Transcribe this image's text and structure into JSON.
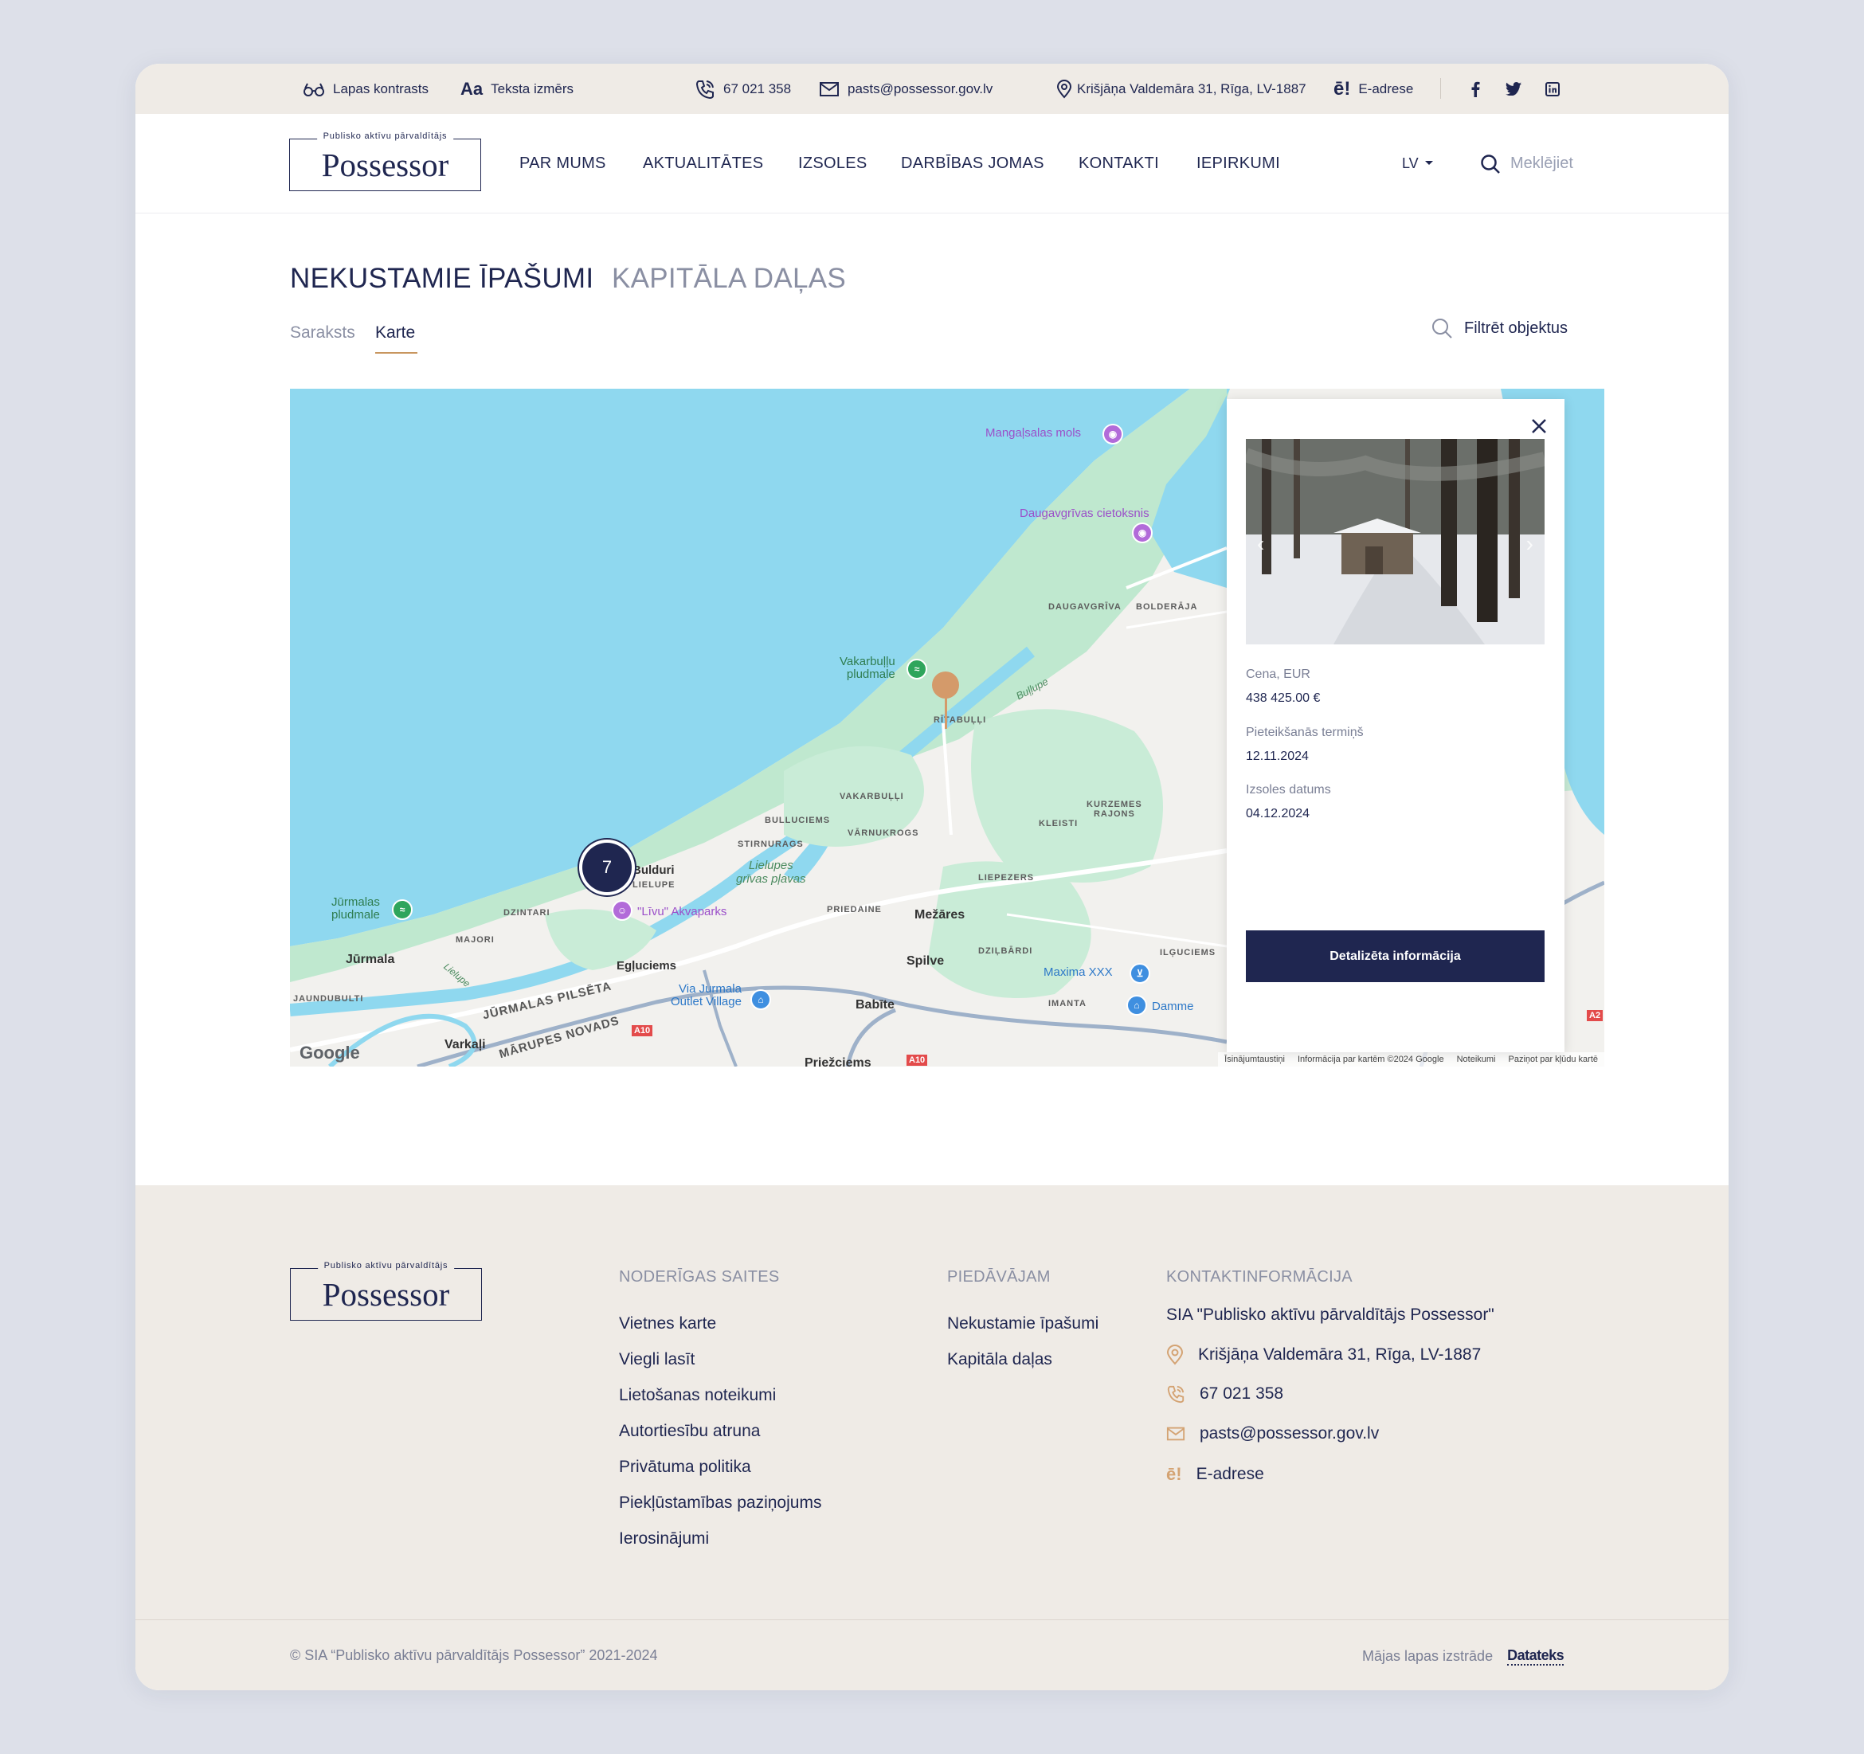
{
  "utility_bar": {
    "contrast_label": "Lapas kontrasts",
    "text_size_label": "Teksta izmērs",
    "phone": "67 021 358",
    "email": "pasts@possessor.gov.lv",
    "address": "Krišjāņa Valdemāra 31, Rīga, LV-1887",
    "e_address": "E-adrese",
    "social": [
      "facebook-icon",
      "twitter-icon",
      "linkedin-icon"
    ]
  },
  "logo": {
    "tagline": "Publisko aktīvu pārvaldītājs",
    "name": "Possessor"
  },
  "nav": {
    "items": [
      "PAR MUMS",
      "AKTUALITĀTES",
      "IZSOLES",
      "DARBĪBAS JOMAS",
      "KONTAKTI",
      "IEPIRKUMI"
    ],
    "language": "LV",
    "search_placeholder": "Meklējiet"
  },
  "page": {
    "tabs": [
      "NEKUSTAMIE ĪPAŠUMI",
      "KAPITĀLA DAĻAS"
    ],
    "active_tab": "NEKUSTAMIE ĪPAŠUMI",
    "subtabs": [
      "Saraksts",
      "Karte"
    ],
    "active_subtab": "Karte",
    "filter_label": "Filtrēt objektus"
  },
  "map": {
    "cluster_count": "7",
    "labels": {
      "mangalsalas": "Mangaļsalas mols",
      "daugavgrivas_cietoksnis": "Daugavgrīvas cietoksnis",
      "daugavgriva": "DAUGAVGRĪVA",
      "bolderaja": "BOLDERĀJA",
      "vakarbullu_pludmale": "Vakarbuļļu\npludmale",
      "ritabulli": "RĪTABUĻĻI",
      "bullupe": "Buļļupe",
      "vakarbulli": "VAKARBUĻĻI",
      "bulluciems": "BULLUCIEMS",
      "varnukrogs": "VĀRNUKROGS",
      "stirnurags": "STIRNURAGS",
      "lielupes_grivas_plavas": "Lielupes\ngrīvas pļavas",
      "kurzemes_rajons": "KURZEMES\nRAJONS",
      "kleisti": "KLEISTI",
      "liepezers": "LIEPEZERS",
      "buldurí": "Bulduri",
      "lielupe_area": "LIELUPE",
      "livu_akvaparks": "\"Līvu\" Akvaparks",
      "dzintari": "DZINTARI",
      "majori": "MAJORI",
      "jurmalas_pludmale": "Jūrmalas\npludmale",
      "jurmala": "Jūrmala",
      "priedaine": "PRIEDAINE",
      "mezares": "Mežāres",
      "dzilbardi": "DZIĻBĀRDI",
      "ilguciems": "ILĢUCIEMS",
      "jaundubulti": "JAUNDUBULTI",
      "jurmalas_pilseta": "JŪRMALAS PILSĒTA",
      "egluciems": "Egļuciems",
      "via_jurmala": "Via Jurmala\nOutlet Village",
      "spilve": "Spilve",
      "maxima": "Maxima XXX",
      "imanta": "IMANTA",
      "damme": "Damme",
      "babite": "Babīte",
      "varkali": "Varkaļi",
      "marupes_novads": "MĀRUPES NOVADS",
      "priezciems": "Priežciems",
      "a10": "A10",
      "a2": "A2",
      "lielupe_river": "Lielupe",
      "google": "Google"
    },
    "attribution": [
      "Īsinājumtaustiņi",
      "Informācija par kartēm ©2024 Google",
      "Noteikumi",
      "Paziņot par kļūdu kartē"
    ]
  },
  "popup": {
    "price_label": "Cena, EUR",
    "price_value": "438 425.00 €",
    "deadline_label": "Pieteikšanās termiņš",
    "deadline_value": "12.11.2024",
    "auction_label": "Izsoles datums",
    "auction_value": "04.12.2024",
    "button_label": "Detalizēta informācija"
  },
  "footer": {
    "useful_links_heading": "NODERĪGAS SAITES",
    "useful_links": [
      "Vietnes karte",
      "Viegli lasīt",
      "Lietošanas noteikumi",
      "Autortiesību atruna",
      "Privātuma politika",
      "Piekļūstamības paziņojums",
      "Ierosinājumi"
    ],
    "offer_heading": "PIEDĀVĀJAM",
    "offer_links": [
      "Nekustamie īpašumi",
      "Kapitāla daļas"
    ],
    "contact_heading": "KONTAKTINFORMĀCIJA",
    "company": "SIA \"Publisko aktīvu pārvaldītājs Possessor\"",
    "address": "Krišjāņa Valdemāra 31, Rīga, LV-1887",
    "phone": "67 021 358",
    "email": "pasts@possessor.gov.lv",
    "e_address": "E-adrese",
    "copyright": "© SIA “Publisko aktīvu pārvaldītājs Possessor” 2021-2024",
    "made_by_label": "Mājas lapas izstrāde",
    "developer": "Datateks"
  },
  "colors": {
    "navy": "#1f2650",
    "gold": "#c8965f",
    "beige": "#efebe6",
    "water": "#8fd8ef",
    "land_green": "#bfe8cf"
  }
}
